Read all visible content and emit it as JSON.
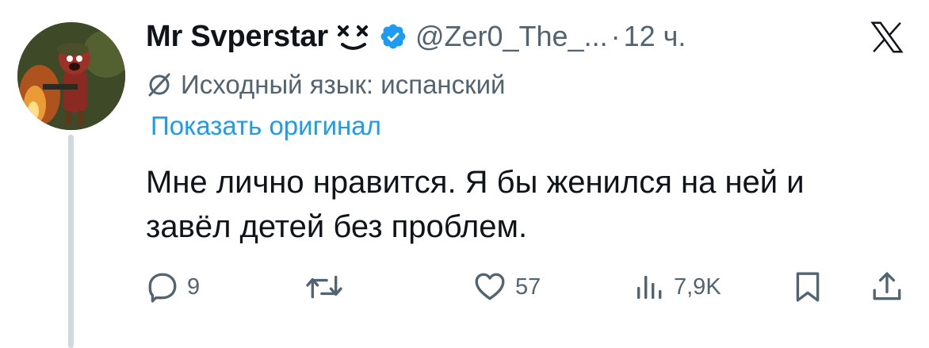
{
  "author": {
    "display_name": "Mr Svperstar",
    "handle": "@Zer0_The_...",
    "separator": "·",
    "time_ago": "12 ч.",
    "name_emoji": "dizzy-face-emoji",
    "verified_badge": "verified-check-icon"
  },
  "translation": {
    "source_language_label": "Исходный язык: испанский",
    "show_original_label": "Показать оригинал"
  },
  "body": {
    "lines": [
      "Мне лично нравится. Я бы женился на ней и",
      "завёл детей без проблем."
    ]
  },
  "actions": {
    "reply_count": "9",
    "retweet_count": "",
    "like_count": "57",
    "views_count": "7,9K"
  },
  "icons": {
    "brand": "x-logo-icon",
    "reply": "reply-bubble-icon",
    "retweet": "retweet-icon",
    "like": "heart-icon",
    "views": "views-bar-chart-icon",
    "bookmark": "bookmark-icon",
    "share": "share-icon",
    "translate": "translate-icon"
  },
  "colors": {
    "text_primary": "#0f1419",
    "text_secondary": "#536471",
    "accent_blue": "#1d9bf0",
    "thread_line": "#cfd9de"
  }
}
